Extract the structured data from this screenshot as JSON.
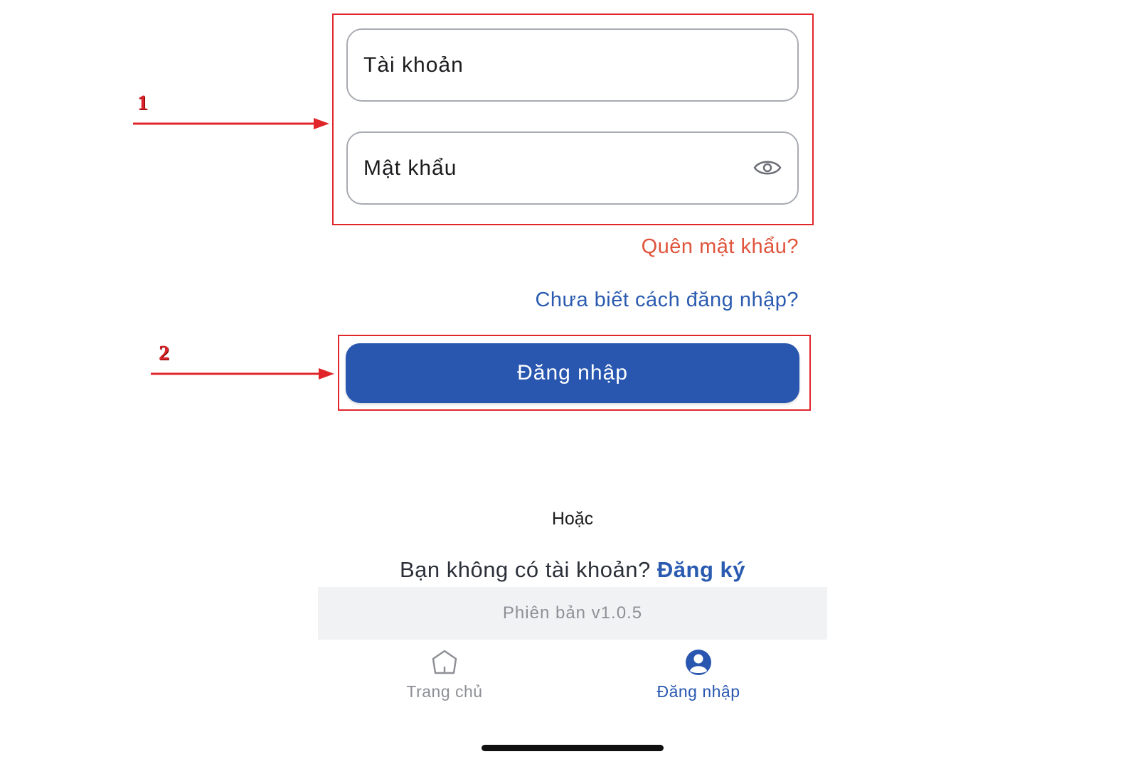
{
  "form": {
    "username_placeholder": "Tài khoản",
    "password_placeholder": "Mật khẩu",
    "forgot_password": "Quên mật khẩu?",
    "how_to_login": "Chưa biết cách đăng nhập?",
    "login_button": "Đăng nhập"
  },
  "alternative": {
    "or_text": "Hoặc",
    "no_account_text": "Bạn không có tài khoản?",
    "register_link": "Đăng ký"
  },
  "version": "Phiên bản v1.0.5",
  "tab_bar": {
    "items": [
      {
        "label": "Trang chủ",
        "icon": "home-icon",
        "active": false
      },
      {
        "label": "Đăng nhập",
        "icon": "user-circle-icon",
        "active": true
      }
    ]
  },
  "annotations": {
    "markers": [
      "1",
      "2"
    ],
    "color": "#e0262b"
  },
  "colors": {
    "primary": "#2957b0",
    "link_blue": "#2a5bb0",
    "forgot_red": "#e0543d",
    "inactive_tab": "#8e9096"
  }
}
